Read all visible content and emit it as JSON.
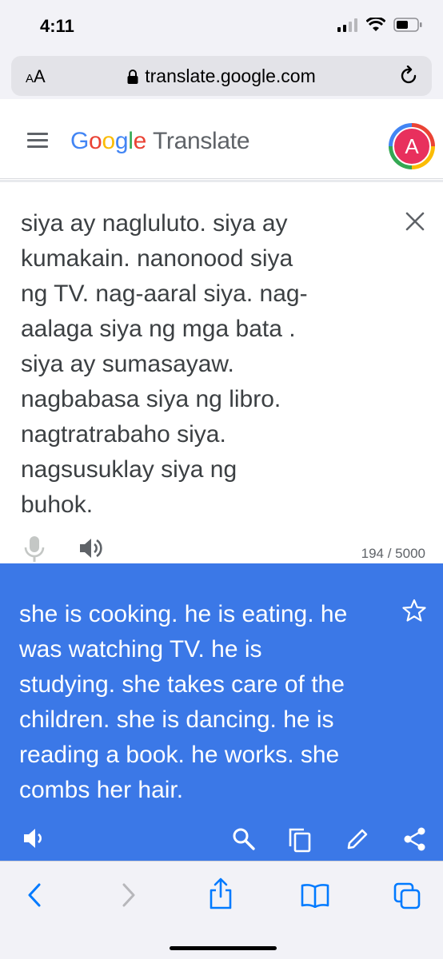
{
  "status_bar": {
    "time": "4:11"
  },
  "browser": {
    "aa_label": "AA",
    "url": "translate.google.com"
  },
  "header": {
    "brand_letters": [
      "G",
      "o",
      "o",
      "g",
      "l",
      "e"
    ],
    "product": "Translate",
    "avatar_letter": "A"
  },
  "source": {
    "text": "siya ay nagluluto. siya ay\nkumakain. nanonood siya\nng TV. nag-aaral siya. nag-\naalaga siya ng mga bata .\nsiya ay sumasayaw.\nnagbabasa siya ng libro.\nnagtratrabaho siya.\nnagsusuklay siya ng\nbuhok.",
    "char_count": "194 / 5000"
  },
  "result": {
    "text": "she is cooking. he is eating. he\nwas watching TV. he is\nstudying. she takes care of the\nchildren. she is dancing. he is\nreading a book. he works. she\ncombs her hair.",
    "background": "#3b78e7"
  },
  "icons": {
    "status": [
      "signal-icon",
      "wifi-icon",
      "battery-icon"
    ],
    "source_tools": [
      "mic-icon",
      "speaker-icon"
    ],
    "result_tools": [
      "speaker-icon",
      "search-icon",
      "copy-icon",
      "edit-icon",
      "share-icon"
    ],
    "browser_toolbar": [
      "back-icon",
      "forward-icon",
      "share-icon",
      "bookmarks-icon",
      "tabs-icon"
    ]
  },
  "colors": {
    "accent_blue": "#3b78e7",
    "ios_blue": "#007aff",
    "avatar": "#e8305d"
  }
}
